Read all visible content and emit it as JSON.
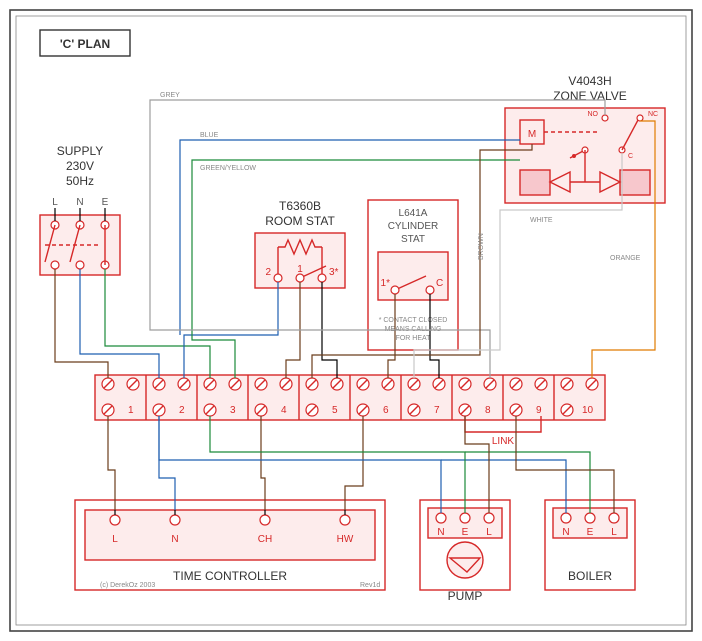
{
  "frame": {
    "title": "'C' PLAN",
    "copyright": "(c) DerekOz 2003",
    "rev": "Rev1d"
  },
  "supply": {
    "title1": "SUPPLY",
    "title2": "230V",
    "title3": "50Hz",
    "l": "L",
    "n": "N",
    "e": "E"
  },
  "roomstat": {
    "title1": "T6360B",
    "title2": "ROOM STAT",
    "t1": "1",
    "t2": "2",
    "t3": "3*"
  },
  "cylstat": {
    "title1": "L641A",
    "title2": "CYLINDER",
    "title3": "STAT",
    "t1": "1*",
    "tc": "C",
    "note1": "* CONTACT CLOSED",
    "note2": "MEANS CALLING",
    "note3": "FOR HEAT"
  },
  "zone": {
    "title1": "V4043H",
    "title2": "ZONE VALVE",
    "m": "M",
    "no": "NO",
    "nc": "NC",
    "c": "C"
  },
  "junction": {
    "link": "LINK",
    "t1": "1",
    "t2": "2",
    "t3": "3",
    "t4": "4",
    "t5": "5",
    "t6": "6",
    "t7": "7",
    "t8": "8",
    "t9": "9",
    "t10": "10"
  },
  "timer": {
    "title": "TIME CONTROLLER",
    "l": "L",
    "n": "N",
    "ch": "CH",
    "hw": "HW"
  },
  "pump": {
    "title": "PUMP",
    "n": "N",
    "e": "E",
    "l": "L"
  },
  "boiler": {
    "title": "BOILER",
    "n": "N",
    "e": "E",
    "l": "L"
  },
  "wirelabels": {
    "grey": "GREY",
    "blue": "BLUE",
    "green": "GREEN/YELLOW",
    "brown": "BROWN",
    "white": "WHITE",
    "orange": "ORANGE"
  }
}
